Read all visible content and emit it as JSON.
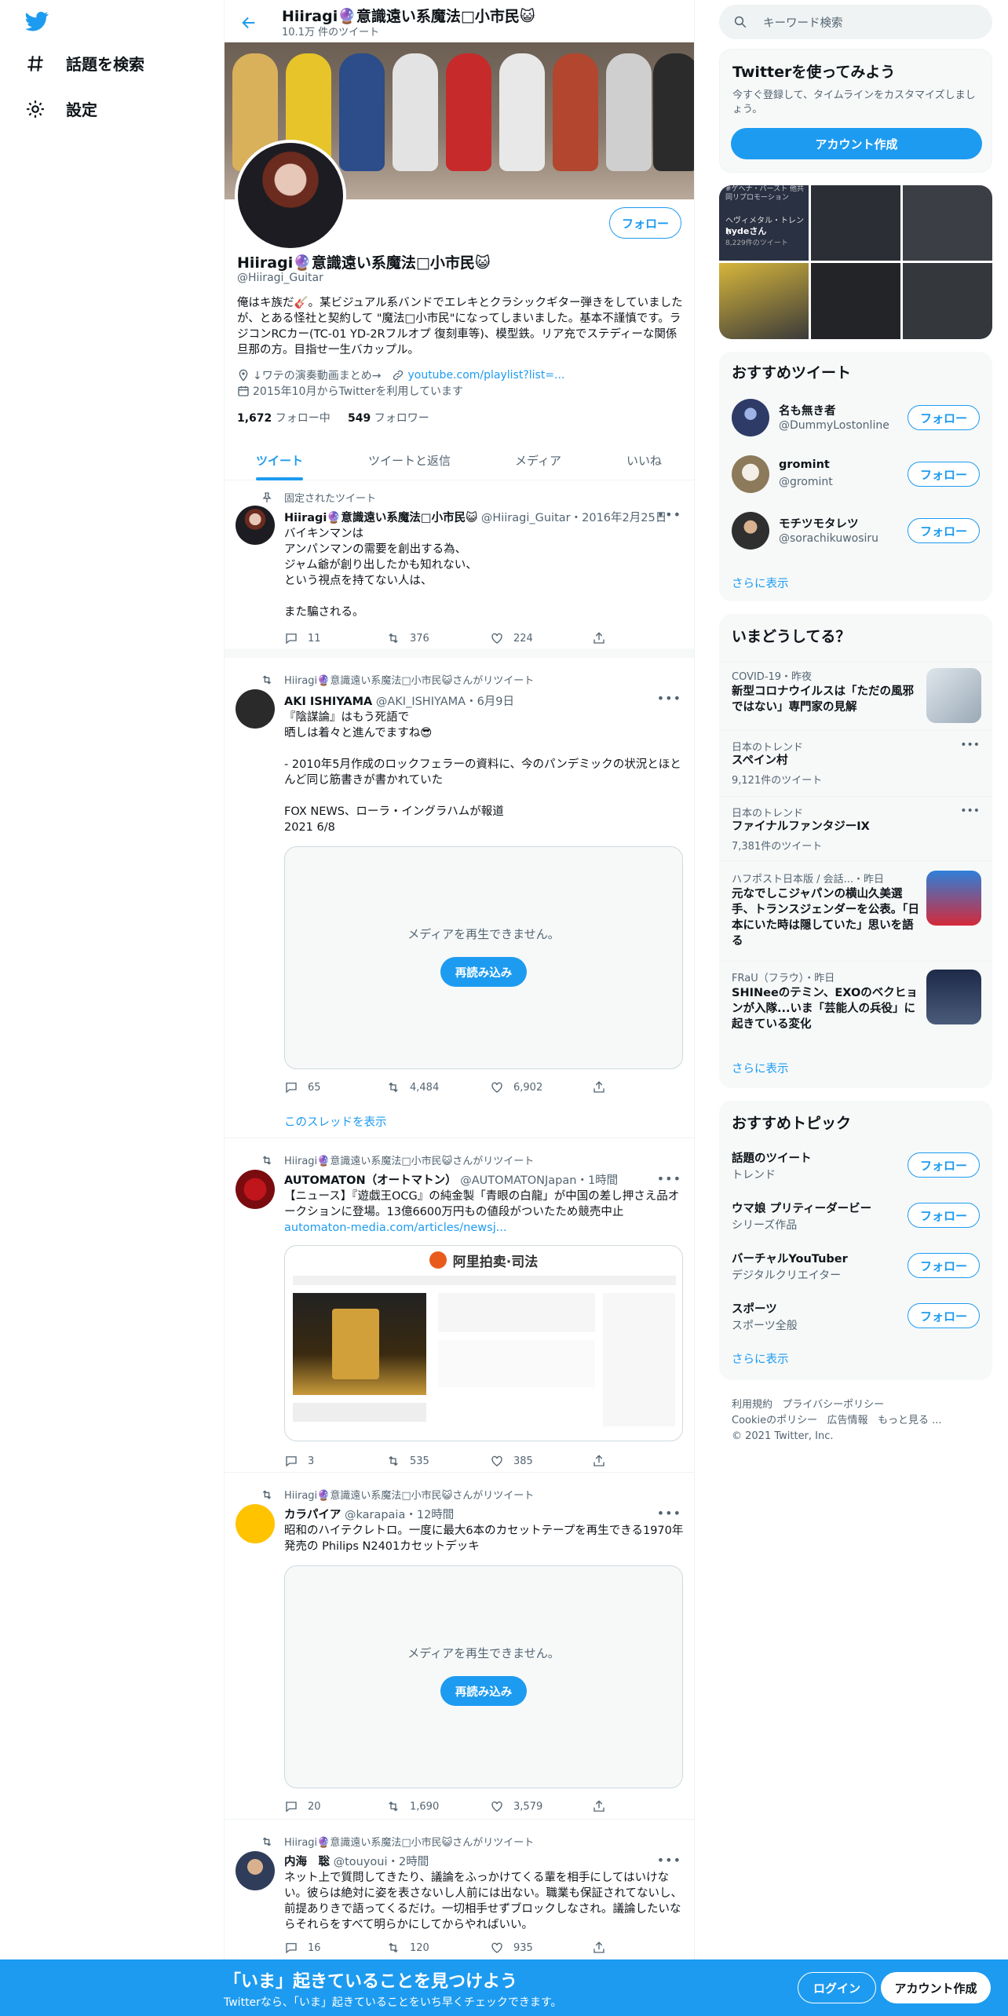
{
  "nav": {
    "explore_label": "話題を検索",
    "settings_label": "設定"
  },
  "header": {
    "title": "Hiiragi🔮意識遠い系魔法□小市民😺",
    "subtitle": "10.1万 件のツイート"
  },
  "profile": {
    "follow_label": "フォロー",
    "name": "Hiiragi🔮意識遠い系魔法□小市民😺",
    "handle": "@Hiiragi_Guitar",
    "bio": "俺はキ族だ🎸。某ビジュアル系バンドでエレキとクラシックギター弾きをしていましたが、とある怪社と契約して \"魔法□小市民\"になってしまいました。基本不謹慎です。ラジコンRCカー(TC-01 YD-2Rフルオプ 復刻車等)、模型鉄。リア充でステディーな関係旦那の方。目指せ一生バカップル。",
    "location": "↓ワテの演奏動画まとめ→",
    "url": "youtube.com/playlist?list=...",
    "joined": "2015年10月からTwitterを利用しています",
    "following_count": "1,672",
    "following_label": "フォロー中",
    "followers_count": "549",
    "followers_label": "フォロワー"
  },
  "tabs": [
    "ツイート",
    "ツイートと返信",
    "メディア",
    "いいね"
  ],
  "tweets": [
    {
      "context": "固定されたツイート",
      "name": "Hiiragi🔮意識遠い系魔法□小市民😺",
      "handle": "@Hiiragi_Guitar",
      "time": "2016年2月25日",
      "text": "バイキンマンは\nアンパンマンの需要を創出する為、\nジャム爺が創り出したかも知れない、\nという視点を持てない人は、\n\nまた騙される。",
      "replies": "11",
      "retweets": "376",
      "likes": "224"
    },
    {
      "context": "Hiiragi🔮意識遠い系魔法□小市民😺さんがリツイート",
      "name": "AKI ISHIYAMA",
      "handle": "@AKI_ISHIYAMA",
      "time": "6月9日",
      "text": "『陰謀論』はもう死語で\n晒しは着々と進んでますね😎\n\n- 2010年5月作成のロックフェラーの資料に、今のパンデミックの状況とほとんど同じ筋書きが書かれていた\n\nFOX NEWS、ローラ・イングラハムが報道\n2021 6/8",
      "media_message": "メディアを再生できません。",
      "reload_label": "再読み込み",
      "replies": "65",
      "retweets": "4,484",
      "likes": "6,902",
      "thread_link": "このスレッドを表示"
    },
    {
      "context": "Hiiragi🔮意識遠い系魔法□小市民😺さんがリツイート",
      "name": "AUTOMATON（オートマトン）",
      "handle": "@AUTOMATONJapan",
      "time": "1時間",
      "text": "【ニュース】『遊戯王OCG』の純金製「青眼の白龍」が中国の差し押さえ品オークションに登場。13億6600万円もの値段がついたため競売中止",
      "link": "automaton-media.com/articles/newsj...",
      "image_title": "阿里拍卖·司法",
      "replies": "3",
      "retweets": "535",
      "likes": "385"
    },
    {
      "context": "Hiiragi🔮意識遠い系魔法□小市民😺さんがリツイート",
      "name": "カラパイア",
      "handle": "@karapaia",
      "time": "12時間",
      "text": "昭和のハイテクレトロ。一度に最大6本のカセットテープを再生できる1970年発売の Philips N2401カセットデッキ",
      "media_message": "メディアを再生できません。",
      "reload_label": "再読み込み",
      "replies": "20",
      "retweets": "1,690",
      "likes": "3,579"
    },
    {
      "context": "Hiiragi🔮意識遠い系魔法□小市民😺さんがリツイート",
      "name": "内海　聡",
      "handle": "@touyoui",
      "time": "2時間",
      "text": "ネット上で質問してきたり、議論をふっかけてくる輩を相手にしてはいけない。彼らは絶対に姿を表さないし人前には出ない。職業も保証されてないし、前提ありきで語ってくるだけ。一切相手せずブロックしなされ。議論したいならそれらをすべて明らかにしてからやればいい。",
      "replies": "16",
      "retweets": "120",
      "likes": "935"
    }
  ],
  "sidebar": {
    "search_placeholder": "キーワード検索",
    "signup_card": {
      "title": "Twitterを使ってみよう",
      "subtitle": "今すぐ登録して、タイムラインをカスタマイズしましょう。",
      "button": "アカウント作成"
    },
    "media_grid": {
      "promo": "#ゲヘナ・バースト 他共同リプロモーション",
      "trend_label": "ヘヴィメタル・トレンド",
      "trend_name": "hydeさん",
      "trend_count": "8,229件のツイート"
    },
    "recommend": {
      "title": "おすすめツイート",
      "users": [
        {
          "name": "名も無き者",
          "handle": "@DummyLostonline"
        },
        {
          "name": "gromint",
          "handle": "@gromint"
        },
        {
          "name": "モチツモタレツ",
          "handle": "@sorachikuwosiru"
        }
      ],
      "follow_label": "フォロー",
      "more": "さらに表示"
    },
    "trends": {
      "title": "いまどうしてる？",
      "items": [
        {
          "meta": "COVID-19・昨夜",
          "title": "新型コロナウイルスは「ただの風邪ではない」専門家の見解"
        },
        {
          "meta": "日本のトレンド",
          "title": "スペイン村",
          "count": "9,121件のツイート"
        },
        {
          "meta": "日本のトレンド",
          "title": "ファイナルファンタジーIX",
          "count": "7,381件のツイート"
        },
        {
          "meta": "ハフポスト日本版 / 会話...・昨日",
          "title": "元なでしこジャパンの横山久美選手、トランスジェンダーを公表。「日本にいた時は隠していた」思いを語る"
        },
        {
          "meta": "FRaU（フラウ）・昨日",
          "title": "SHINeeのテミン、EXOのベクヒョンが入隊...いま「芸能人の兵役」に起きている変化"
        }
      ],
      "more": "さらに表示"
    },
    "topics": {
      "title": "おすすめトピック",
      "items": [
        {
          "name": "話題のツイート",
          "sub": "トレンド"
        },
        {
          "name": "ウマ娘 プリティーダービー",
          "sub": "シリーズ作品"
        },
        {
          "name": "バーチャルYouTuber",
          "sub": "デジタルクリエイター"
        },
        {
          "name": "スポーツ",
          "sub": "スポーツ全般"
        }
      ],
      "follow_label": "フォロー",
      "more": "さらに表示"
    },
    "footer": {
      "terms": "利用規約",
      "privacy": "プライバシーポリシー",
      "cookie": "Cookieのポリシー",
      "ads": "広告情報",
      "more": "もっと見る ...",
      "copyright": "© 2021 Twitter, Inc."
    }
  },
  "bottom_bar": {
    "title": "「いま」起きていることを見つけよう",
    "subtitle": "Twitterなら、「いま」起きていることをいち早くチェックできます。",
    "login": "ログイン",
    "signup": "アカウント作成"
  },
  "colors": {
    "accent": "#1d9bf0",
    "text": "#0f1419",
    "muted": "#536471"
  }
}
